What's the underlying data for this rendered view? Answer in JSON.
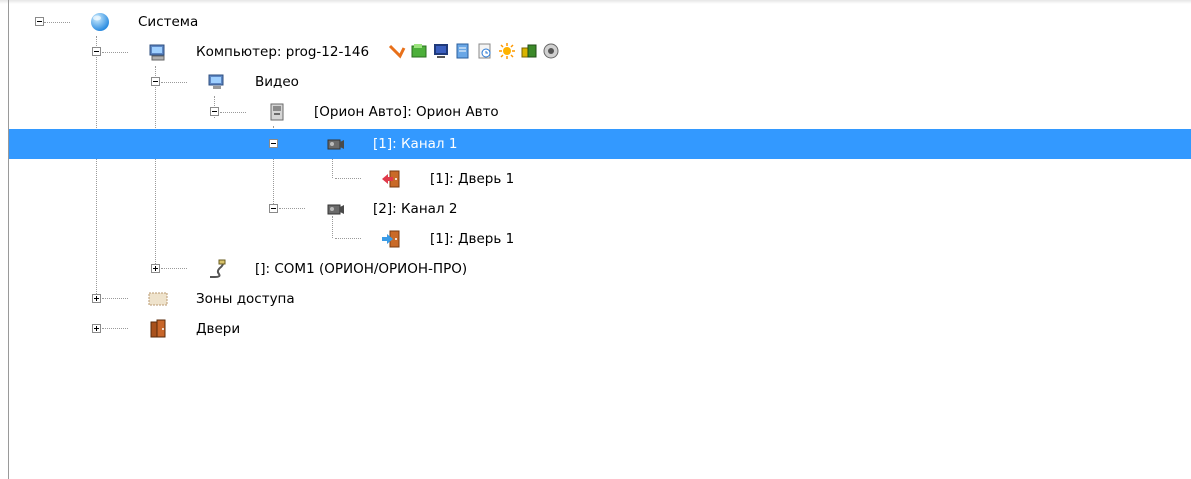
{
  "tree": {
    "root": {
      "label": "Система",
      "icon": "globe-icon"
    },
    "computer": {
      "label": "Компьютер: prog-12-146",
      "icon": "computer-icon",
      "tools": [
        "arrow-icon",
        "folder-icon",
        "monitor-icon",
        "document-icon",
        "clock-icon",
        "sun-icon",
        "coins-icon",
        "speaker-icon"
      ]
    },
    "video": {
      "label": "Видео",
      "icon": "monitor-icon"
    },
    "orion": {
      "label": "[Орион Авто]: Орион Авто",
      "icon": "server-icon"
    },
    "channel1": {
      "label": "[1]: Канал 1",
      "icon": "camera-icon",
      "selected": true
    },
    "door1a": {
      "label": "[1]: Дверь 1",
      "icon": "door-exit-icon"
    },
    "channel2": {
      "label": "[2]: Канал 2",
      "icon": "camera-icon"
    },
    "door1b": {
      "label": "[1]: Дверь 1",
      "icon": "door-enter-icon"
    },
    "com1": {
      "label": "[]: COM1 (ОРИОН/ОРИОН-ПРО)",
      "icon": "cable-icon"
    },
    "zones": {
      "label": "Зоны доступа",
      "icon": "zone-icon"
    },
    "doors": {
      "label": "Двери",
      "icon": "doors-icon"
    }
  },
  "colors": {
    "selection": "#3399ff",
    "selection_text": "#ffffff"
  }
}
